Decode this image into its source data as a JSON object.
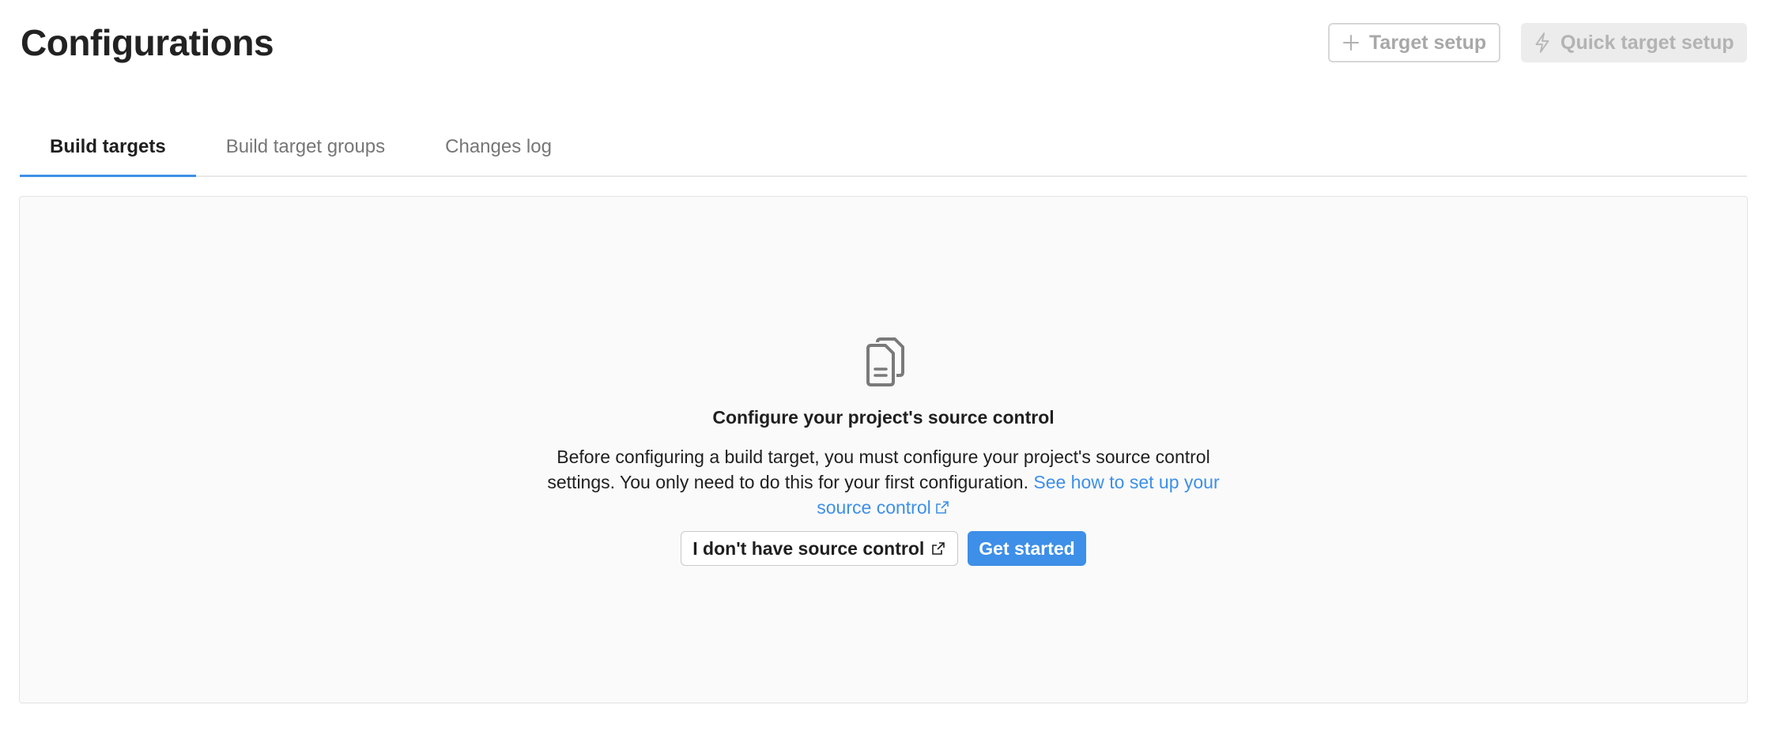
{
  "header": {
    "title": "Configurations",
    "target_setup_label": "Target setup",
    "quick_target_setup_label": "Quick target setup"
  },
  "tabs": [
    {
      "label": "Build targets",
      "active": true
    },
    {
      "label": "Build target groups",
      "active": false
    },
    {
      "label": "Changes log",
      "active": false
    }
  ],
  "empty_state": {
    "icon": "documents-icon",
    "title": "Configure your project's source control",
    "description": "Before configuring a build target, you must configure your project's source control settings. You only need to do this for your first configuration.",
    "link_text": "See how to set up your source control",
    "secondary_button": "I don't have source control",
    "primary_button": "Get started"
  },
  "colors": {
    "accent": "#3d8fe8",
    "panel_bg": "#fafafa",
    "disabled_text": "#a8a8a8"
  }
}
